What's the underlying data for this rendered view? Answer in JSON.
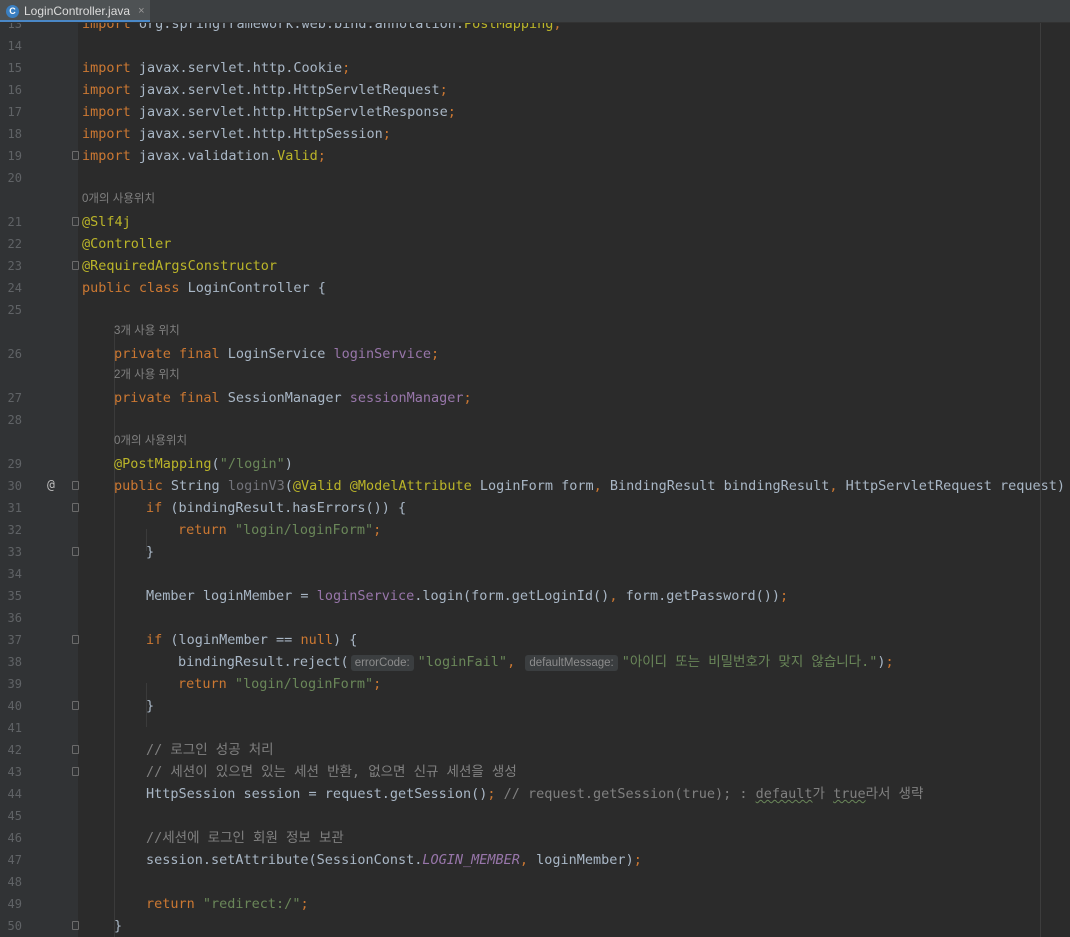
{
  "tab": {
    "filename": "LoginController.java",
    "icon": "java-class-icon",
    "close": "×"
  },
  "colors": {
    "keyword": "#cc7832",
    "annotation": "#bbb529",
    "string": "#6a8759",
    "field": "#9876aa",
    "comment": "#808080",
    "default": "#a9b7c6",
    "background": "#2b2b2b"
  },
  "lines": {
    "l13": {
      "num": "13",
      "t1": "import ",
      "t2": "org.springframework.web.bind.annotation.",
      "t3": "PostMapping",
      "t4": ";"
    },
    "l14": {
      "num": "14"
    },
    "l15": {
      "num": "15",
      "kw": "import",
      "rest": " javax.servlet.http.Cookie",
      "semi": ";"
    },
    "l16": {
      "num": "16",
      "kw": "import",
      "rest": " javax.servlet.http.HttpServletRequest",
      "semi": ";"
    },
    "l17": {
      "num": "17",
      "kw": "import",
      "rest": " javax.servlet.http.HttpServletResponse",
      "semi": ";"
    },
    "l18": {
      "num": "18",
      "kw": "import",
      "rest": " javax.servlet.http.HttpSession",
      "semi": ";"
    },
    "l19": {
      "num": "19",
      "kw": "import",
      "rest": " javax.validation.",
      "cls": "Valid",
      "semi": ";"
    },
    "l20": {
      "num": "20"
    },
    "hint1": "0개의 사용위치",
    "l21": {
      "num": "21",
      "ann": "@Slf4j"
    },
    "l22": {
      "num": "22",
      "ann": "@Controller"
    },
    "l23": {
      "num": "23",
      "ann": "@RequiredArgsConstructor"
    },
    "l24": {
      "num": "24",
      "kw": "public class",
      "rest": " LoginController {"
    },
    "l25": {
      "num": "25"
    },
    "hint2": "3개 사용 위치",
    "l26": {
      "num": "26",
      "kw": "private final",
      "type": " LoginService ",
      "field": "loginService",
      "semi": ";"
    },
    "hint3": "2개 사용 위치",
    "l27": {
      "num": "27",
      "kw": "private final",
      "type": " SessionManager ",
      "field": "sessionManager",
      "semi": ";"
    },
    "l28": {
      "num": "28"
    },
    "hint4": "0개의 사용위치",
    "l29": {
      "num": "29",
      "ann": "@PostMapping",
      "p1": "(",
      "str": "\"/login\"",
      "p2": ")"
    },
    "l30": {
      "num": "30",
      "gutter": "@",
      "kw": "public",
      "type": " String ",
      "method": "loginV3",
      "p1": "(",
      "ann1": "@Valid",
      "sp": " ",
      "ann2": "@ModelAttribute",
      "params": " LoginForm form",
      "c1": ",",
      "params2": " BindingResult bindingResult",
      "c2": ",",
      "params3": " HttpServletRequest request) {"
    },
    "l31": {
      "num": "31",
      "kw": "if",
      "rest": " (bindingResult.hasErrors()) {"
    },
    "l32": {
      "num": "32",
      "kw": "return",
      "str": " \"login/loginForm\"",
      "semi": ";"
    },
    "l33": {
      "num": "33",
      "rest": "}"
    },
    "l34": {
      "num": "34"
    },
    "l35": {
      "num": "35",
      "rest1": "Member loginMember = ",
      "field": "loginService",
      "rest2": ".login(form.getLoginId()",
      "c": ",",
      "rest3": " form.getPassword())",
      "semi": ";"
    },
    "l36": {
      "num": "36"
    },
    "l37": {
      "num": "37",
      "kw": "if",
      "rest1": " (loginMember == ",
      "kw2": "null",
      "rest2": ") {"
    },
    "l38": {
      "num": "38",
      "rest1": "bindingResult.reject(",
      "ph1": "errorCode:",
      "str1": "\"loginFail\"",
      "c": ", ",
      "ph2": "defaultMessage:",
      "str2": "\"아이디 또는 비밀번호가 맞지 않습니다.\"",
      "rest2": ")",
      "semi": ";"
    },
    "l39": {
      "num": "39",
      "kw": "return",
      "str": " \"login/loginForm\"",
      "semi": ";"
    },
    "l40": {
      "num": "40",
      "rest": "}"
    },
    "l41": {
      "num": "41"
    },
    "l42": {
      "num": "42",
      "cmt": "// 로그인 성공 처리"
    },
    "l43": {
      "num": "43",
      "cmt": "// 세션이 있으면 있는 세션 반환, 없으면 신규 세션을 생성"
    },
    "l44": {
      "num": "44",
      "rest": "HttpSession session = request.getSession()",
      "semi": ";",
      "cmt1": " // request.getSession(true); : ",
      "cmt2": "default",
      "cmt3": "가 ",
      "cmt4": "true",
      "cmt5": "라서 생략"
    },
    "l45": {
      "num": "45"
    },
    "l46": {
      "num": "46",
      "cmt": "//세션에 로그인 회원 정보 보관"
    },
    "l47": {
      "num": "47",
      "rest1": "session.setAttribute(SessionConst.",
      "const": "LOGIN_MEMBER",
      "c": ",",
      "rest2": " loginMember)",
      "semi": ";"
    },
    "l48": {
      "num": "48"
    },
    "l49": {
      "num": "49",
      "kw": "return",
      "str": " \"redirect:/\"",
      "semi": ";"
    },
    "l50": {
      "num": "50",
      "rest": "}"
    }
  }
}
